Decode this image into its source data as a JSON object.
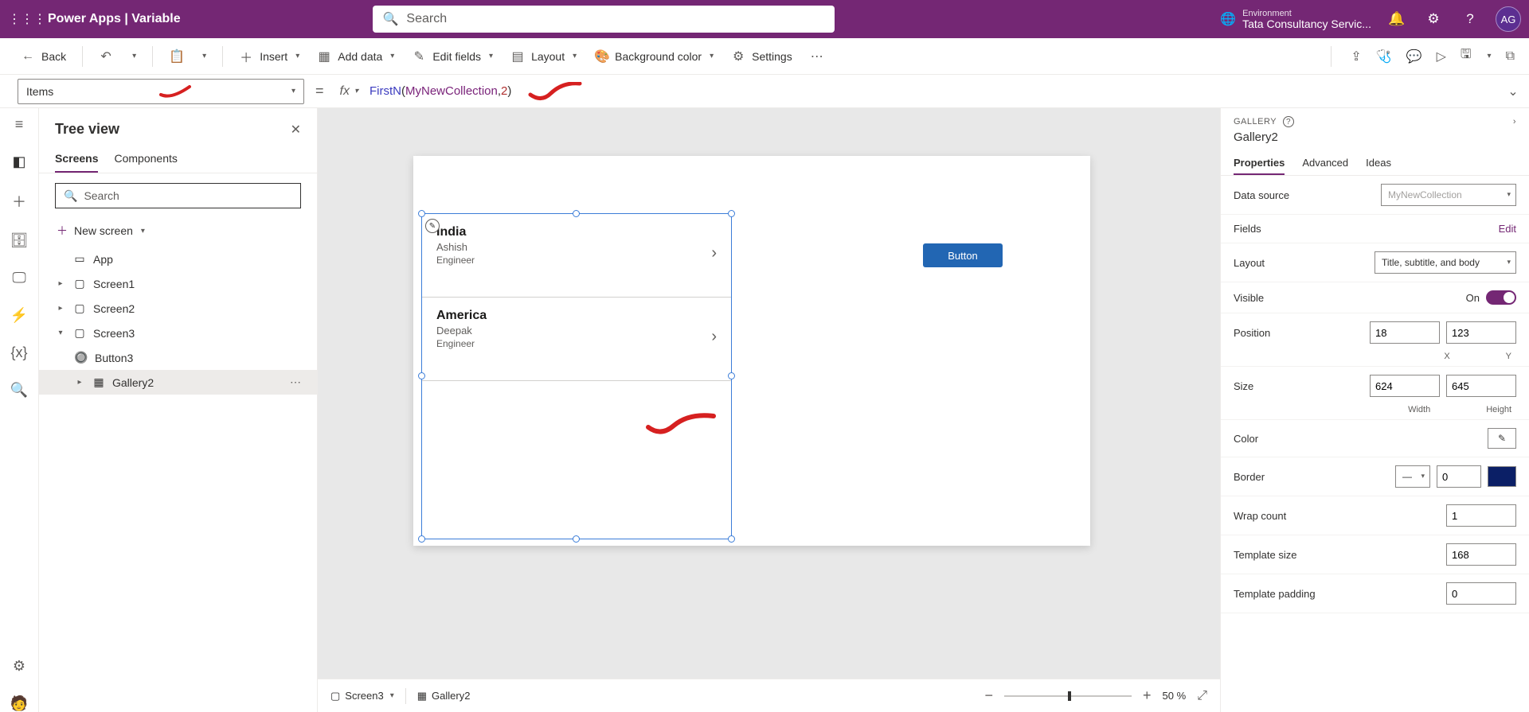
{
  "header": {
    "brand": "Power Apps   |   Variable",
    "search_placeholder": "Search",
    "env_label": "Environment",
    "env_name": "Tata Consultancy Servic...",
    "avatar": "AG"
  },
  "cmd": {
    "back": "Back",
    "insert": "Insert",
    "add_data": "Add data",
    "edit_fields": "Edit fields",
    "layout": "Layout",
    "bg_color": "Background color",
    "settings": "Settings"
  },
  "formula": {
    "property": "Items",
    "fx": "fx",
    "fn": "FirstN",
    "arg1": "MyNewCollection",
    "arg2": "2"
  },
  "tree": {
    "title": "Tree view",
    "tab_screens": "Screens",
    "tab_components": "Components",
    "search_placeholder": "Search",
    "new_screen": "New screen",
    "nodes": {
      "app": "App",
      "screen1": "Screen1",
      "screen2": "Screen2",
      "screen3": "Screen3",
      "button3": "Button3",
      "gallery2": "Gallery2"
    }
  },
  "canvas": {
    "items": [
      {
        "title": "India",
        "sub": "Ashish",
        "body": "Engineer"
      },
      {
        "title": "America",
        "sub": "Deepak",
        "body": "Engineer"
      }
    ],
    "button_label": "Button"
  },
  "status": {
    "screen": "Screen3",
    "element": "Gallery2",
    "zoom": "50",
    "zoom_pct": "%"
  },
  "props": {
    "header": "GALLERY",
    "name": "Gallery2",
    "tab_properties": "Properties",
    "tab_advanced": "Advanced",
    "tab_ideas": "Ideas",
    "data_source_label": "Data source",
    "data_source_value": "MyNewCollection",
    "fields_label": "Fields",
    "fields_edit": "Edit",
    "layout_label": "Layout",
    "layout_value": "Title, subtitle, and body",
    "visible_label": "Visible",
    "visible_on": "On",
    "position_label": "Position",
    "pos_x": "18",
    "pos_y": "123",
    "pos_x_lbl": "X",
    "pos_y_lbl": "Y",
    "size_label": "Size",
    "size_w": "624",
    "size_h": "645",
    "size_w_lbl": "Width",
    "size_h_lbl": "Height",
    "color_label": "Color",
    "border_label": "Border",
    "border_val": "0",
    "wrap_label": "Wrap count",
    "wrap_val": "1",
    "tmpl_size_label": "Template size",
    "tmpl_size_val": "168",
    "tmpl_pad_label": "Template padding",
    "tmpl_pad_val": "0"
  }
}
